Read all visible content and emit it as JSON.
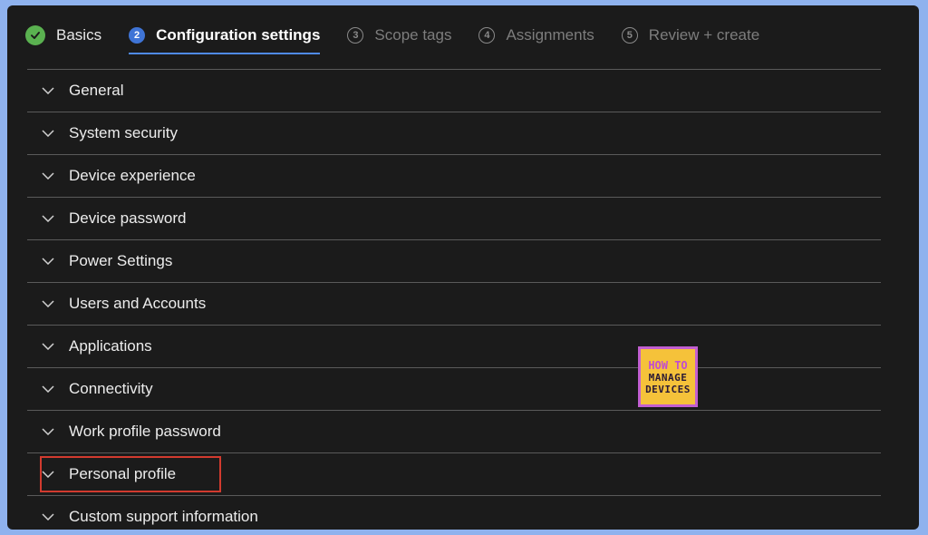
{
  "wizard": {
    "steps": [
      {
        "number": "",
        "label": "Basics",
        "state": "done"
      },
      {
        "number": "2",
        "label": "Configuration settings",
        "state": "current"
      },
      {
        "number": "3",
        "label": "Scope tags",
        "state": "future"
      },
      {
        "number": "4",
        "label": "Assignments",
        "state": "future"
      },
      {
        "number": "5",
        "label": "Review + create",
        "state": "future"
      }
    ]
  },
  "sections": [
    {
      "label": "General"
    },
    {
      "label": "System security"
    },
    {
      "label": "Device experience"
    },
    {
      "label": "Device password"
    },
    {
      "label": "Power Settings"
    },
    {
      "label": "Users and Accounts"
    },
    {
      "label": "Applications"
    },
    {
      "label": "Connectivity"
    },
    {
      "label": "Work profile password"
    },
    {
      "label": "Personal profile",
      "highlighted": true
    },
    {
      "label": "Custom support information"
    }
  ],
  "watermark": {
    "line1": "HOW TO",
    "line2": "MANAGE",
    "line3": "DEVICES"
  },
  "colors": {
    "done": "#5ab150",
    "current": "#3f74d6",
    "highlight": "#d23b2f",
    "background": "#1b1b1b"
  }
}
